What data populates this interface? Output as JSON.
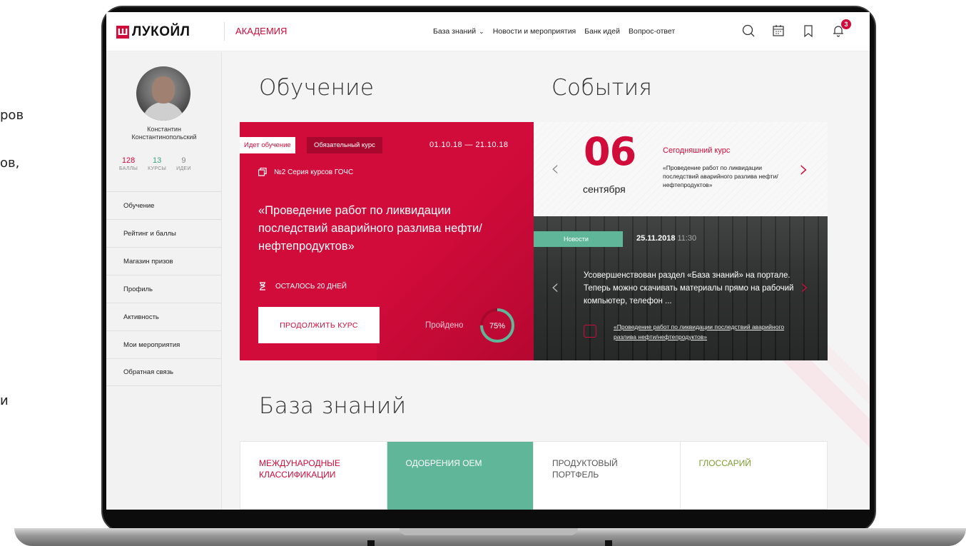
{
  "side_fragments": [
    "ров",
    "",
    "ов,",
    "",
    "",
    "",
    "",
    "",
    "",
    "",
    "",
    "",
    "",
    "",
    "",
    "",
    "",
    "",
    "",
    "",
    "",
    "и"
  ],
  "header": {
    "logo_text": "ЛУКОЙЛ",
    "logo_mark": "Ш",
    "section": "АКАДЕМИЯ",
    "nav": [
      {
        "label": "База знаний",
        "has_dropdown": true
      },
      {
        "label": "Новости и мероприятия"
      },
      {
        "label": "Банк идей"
      },
      {
        "label": "Вопрос-ответ"
      }
    ],
    "notifications_count": "3",
    "icons": [
      "search-icon",
      "calendar-icon",
      "bookmark-icon",
      "bell-icon"
    ]
  },
  "user": {
    "first_name": "Константин",
    "last_name": "Константинопольский",
    "stats": [
      {
        "value": "128",
        "label": "БАЛЛЫ",
        "color": "#d10b3a"
      },
      {
        "value": "13",
        "label": "КУРСЫ",
        "color": "#3aa57f"
      },
      {
        "value": "9",
        "label": "ИДЕИ",
        "color": "#888888"
      }
    ]
  },
  "sidebar_menu": [
    "Обучение",
    "Рейтинг и баллы",
    "Магазин призов",
    "Профиль",
    "Активность",
    "Мои мероприятия",
    "Обратная связь"
  ],
  "learning": {
    "heading": "Обучение",
    "status_tag": "Идет обучение",
    "type_tag": "Обязательный курс",
    "dates": "01.10.18 — 21.10.18",
    "series": "№2 Серия курсов ГОЧС",
    "title": "«Проведение работ по ликвидации последствий аварийного разлива нефти/нефтепродуктов»",
    "remaining": "ОСТАЛОСЬ 20 ДНЕЙ",
    "continue_button": "ПРОДОЛЖИТЬ КУРС",
    "passed_label": "Пройдено",
    "progress_text": "75%",
    "progress": 0.75
  },
  "events": {
    "heading": "События",
    "day": "06",
    "month": "сентября",
    "today_label": "Сегодняшний курс",
    "today_course": "«Проведение работ по ликвидации последствий аварийного разлива нефти/нефтепродуктов»",
    "news_tag": "Новости",
    "news_date": "25.11.2018",
    "news_time": "11:30",
    "news_text": "Усовершенствован раздел «База знаний» на портале. Теперь можно скачивать материалы прямо на рабочий компьютер, телефон ...",
    "news_link": "«Проведение работ по ликвидации последствий аварийного разлива нефти/нефтепродуктов»"
  },
  "knowledge": {
    "heading": "База знаний",
    "tabs": [
      {
        "label": "МЕЖДУНАРОДНЫЕ КЛАССИФИКАЦИИ",
        "style": "red"
      },
      {
        "label": "ОДОБРЕНИЯ OEM",
        "style": "active"
      },
      {
        "label": "ПРОДУКТОВЫЙ ПОРТФЕЛЬ",
        "style": "grey"
      },
      {
        "label": "ГЛОССАРИЙ",
        "style": "green"
      }
    ]
  },
  "colors": {
    "brand_red": "#d10b3a",
    "teal": "#5fb699",
    "olive": "#7c9d34"
  }
}
